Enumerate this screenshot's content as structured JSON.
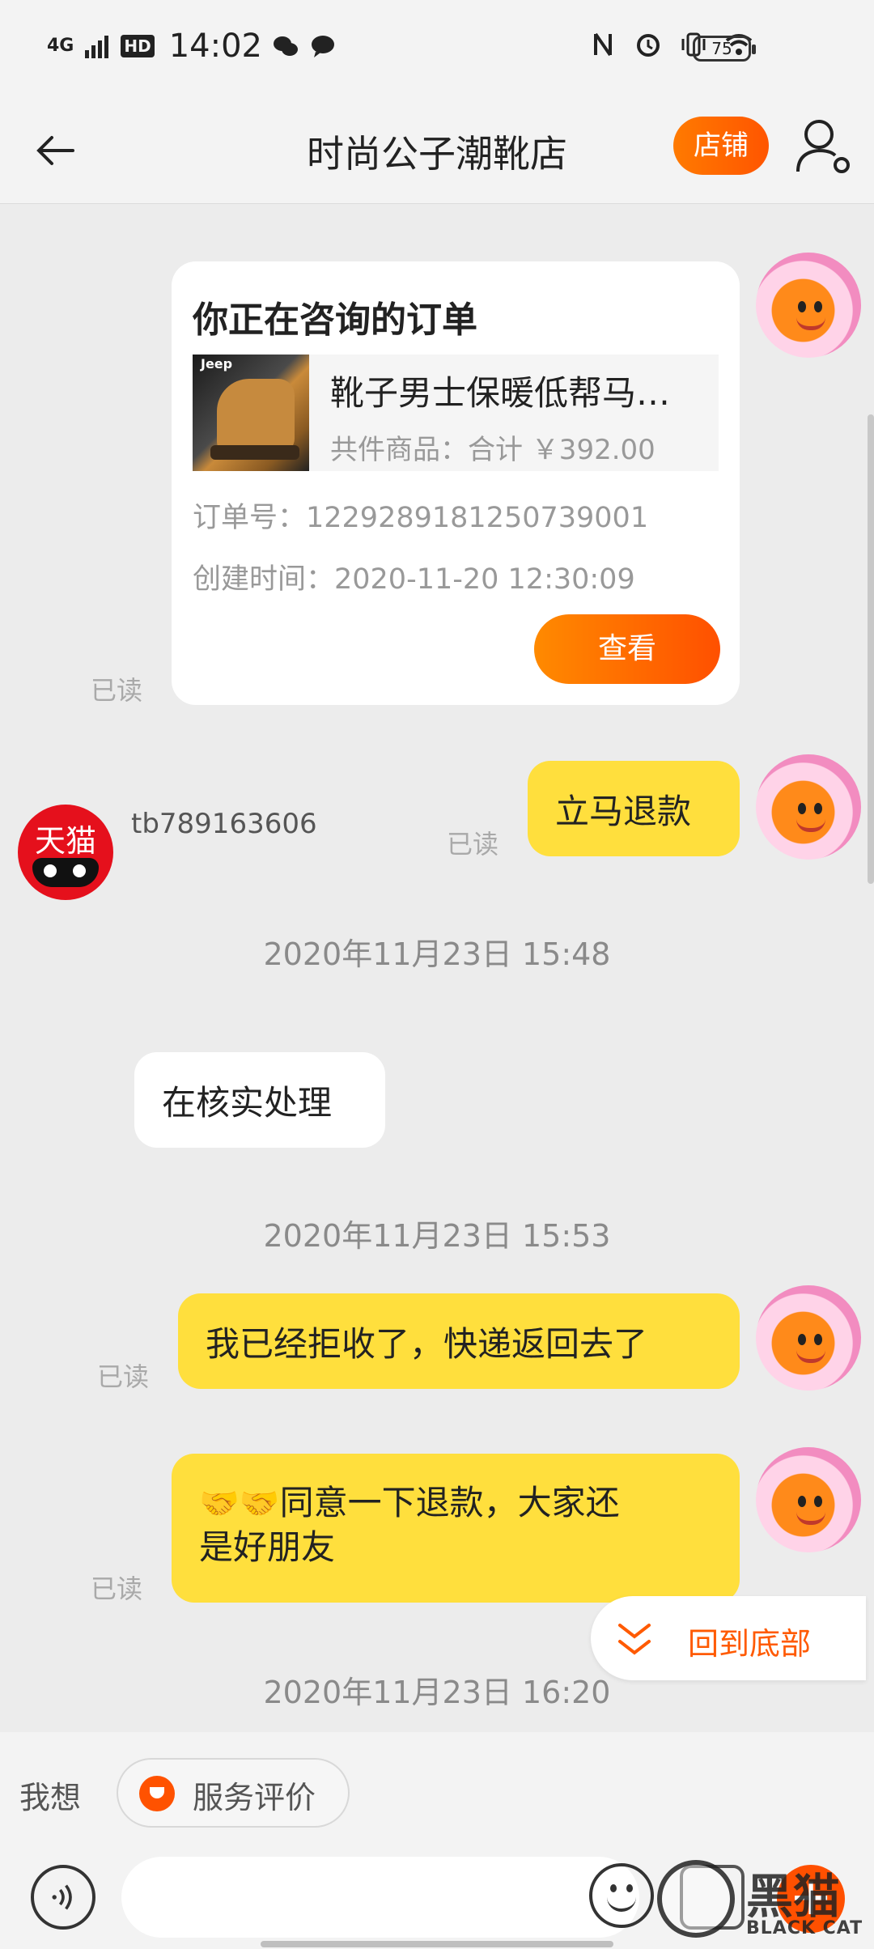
{
  "status_bar": {
    "network": "4G",
    "hd": "HD",
    "time": "14:02",
    "battery": "75",
    "icons": [
      "signal-icon",
      "wechat-icon",
      "message-icon",
      "nfc-icon",
      "alarm-icon",
      "vibrate-icon",
      "wifi-icon",
      "battery-icon"
    ]
  },
  "header": {
    "title": "时尚公子潮靴店",
    "shop_button": "店铺",
    "back_icon": "back-arrow-icon",
    "profile_icon": "user-settings-icon"
  },
  "chat": {
    "order_card": {
      "title": "你正在咨询的订单",
      "product_brand": "Jeep",
      "product_name": "靴子男士保暖低帮马丁靴",
      "total": "共件商品：合计 ￥392.00",
      "order_no": "订单号：1229289181250739001",
      "created": "创建时间：2020-11-20 12:30:09",
      "view_button": "查看",
      "read_status": "已读"
    },
    "messages": [
      {
        "from": "self",
        "text": "立马退款",
        "read": "已读"
      },
      {
        "timestamp": "2020年11月23日 15:48"
      },
      {
        "from": "shop",
        "sender": "tb789163606",
        "avatar_text": "天猫",
        "text": "在核实处理"
      },
      {
        "timestamp": "2020年11月23日 15:53"
      },
      {
        "from": "self",
        "text": "我已经拒收了，快递返回去了",
        "read": "已读"
      },
      {
        "from": "self",
        "emoji": "🤝🤝",
        "text_line1": "同意一下退款，大家还",
        "text_line2": "是好朋友",
        "read": "已读"
      },
      {
        "timestamp": "2020年11月23日 16:20"
      }
    ],
    "back_to_bottom": "回到底部"
  },
  "quick_bar": {
    "label": "我想",
    "chip": "服务评价"
  },
  "input_bar": {
    "placeholder": "",
    "icons": [
      "voice-icon",
      "emoji-icon",
      "shopping-bag-icon",
      "plus-icon"
    ]
  },
  "watermark": {
    "text": "黑猫",
    "subtext": "BLACK CAT"
  },
  "colors": {
    "accent_orange": "#ff5a00",
    "self_bubble": "#ffdf3d",
    "background": "#ececec"
  }
}
